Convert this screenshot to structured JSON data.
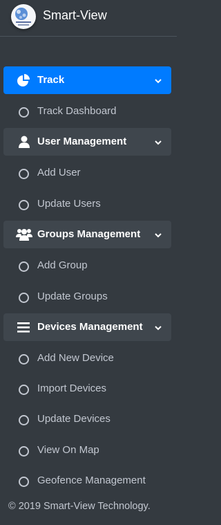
{
  "brand": {
    "title": "Smart-View",
    "logo_icon": "globe-logo-icon"
  },
  "colors": {
    "sidebar_bg": "#343a40",
    "active_bg": "#007bff",
    "header_bg": "#3f464d",
    "text": "#c2c7d0"
  },
  "menu": {
    "track": {
      "label": "Track",
      "icon": "pie-chart-icon",
      "items": [
        "Track Dashboard"
      ]
    },
    "users": {
      "label": "User Management",
      "icon": "user-icon",
      "items": [
        "Add User",
        "Update Users"
      ]
    },
    "groups": {
      "label": "Groups Management",
      "icon": "users-icon",
      "items": [
        "Add Group",
        "Update Groups"
      ]
    },
    "devices": {
      "label": "Devices Management",
      "icon": "bars-icon",
      "items": [
        "Add New Device",
        "Import Devices",
        "Update Devices",
        "View On Map",
        "Geofence Management"
      ]
    }
  },
  "footer": {
    "text": "© 2019 Smart-View Technology."
  }
}
